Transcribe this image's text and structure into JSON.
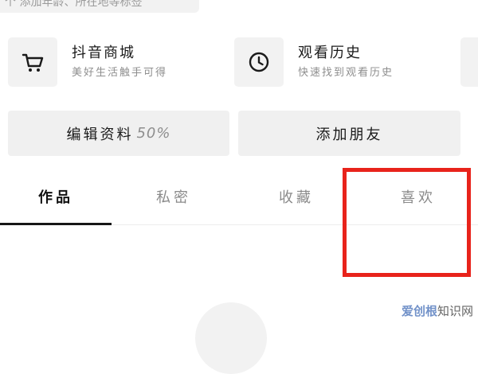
{
  "profile": {
    "intro_partial": "个 添加年龄、所在地等标签"
  },
  "services": [
    {
      "title": "抖音商城",
      "subtitle": "美好生活触手可得",
      "icon": "cart-icon"
    },
    {
      "title": "观看历史",
      "subtitle": "快速找到观看历史",
      "icon": "clock-icon"
    }
  ],
  "actions": {
    "edit_label": "编辑资料",
    "edit_progress": "50%",
    "add_friend_label": "添加朋友"
  },
  "tabs": [
    {
      "label": "作品",
      "active": true
    },
    {
      "label": "私密",
      "active": false
    },
    {
      "label": "收藏",
      "active": false
    },
    {
      "label": "喜欢",
      "active": false
    }
  ],
  "annotation": {
    "color": "#e8231b"
  },
  "watermark": {
    "brand": "爱创根",
    "text": "知识网"
  },
  "colors": {
    "background": "#ffffff",
    "card": "#f2f2f2",
    "text_primary": "#1a1a1a",
    "text_secondary": "#8e8e8e",
    "tab_indicator": "#161616"
  }
}
